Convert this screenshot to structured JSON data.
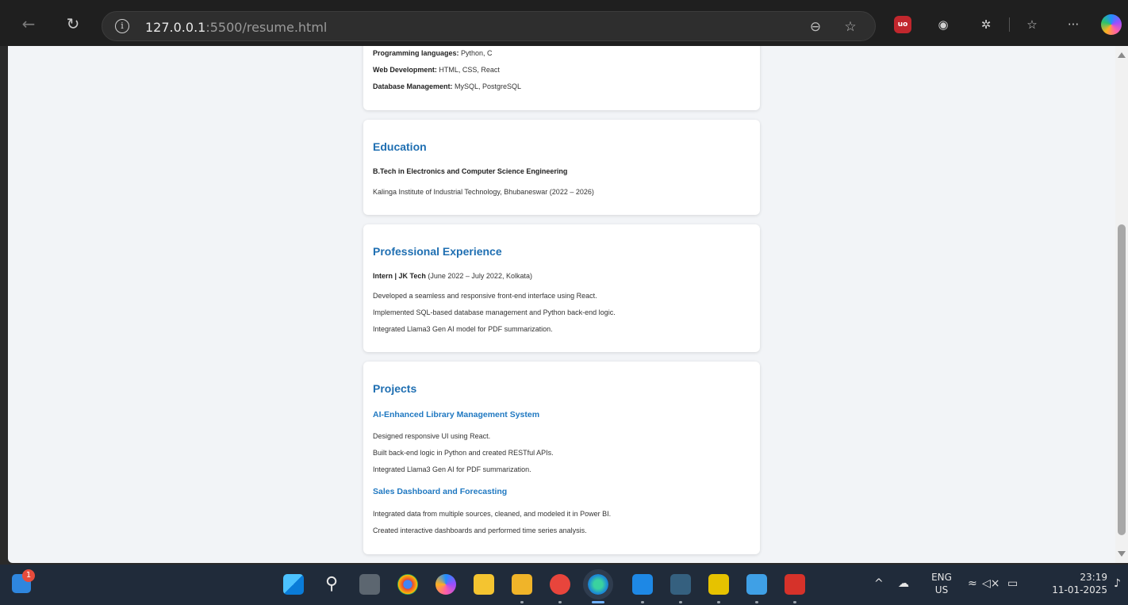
{
  "browser": {
    "url_host": "127.0.0.1",
    "url_rest": ":5500/resume.html"
  },
  "skills": [
    {
      "label": "Programming languages:",
      "value": " Python, C"
    },
    {
      "label": "Web Development:",
      "value": " HTML, CSS, React"
    },
    {
      "label": "Database Management:",
      "value": " MySQL, PostgreSQL"
    }
  ],
  "education": {
    "heading": "Education",
    "degree": "B.Tech in Electronics and Computer Science Engineering",
    "institution": "Kalinga Institute of Industrial Technology, Bhubaneswar (2022 – 2026)"
  },
  "experience": {
    "heading": "Professional Experience",
    "role": "Intern | JK Tech",
    "role_detail": " (June 2022 – July 2022, Kolkata)",
    "points": [
      "Developed a seamless and responsive front-end interface using React.",
      "Implemented SQL-based database management and Python back-end logic.",
      "Integrated Llama3 Gen AI model for PDF summarization."
    ]
  },
  "projects": {
    "heading": "Projects",
    "items": [
      {
        "title": "AI-Enhanced Library Management System",
        "points": [
          "Designed responsive UI using React.",
          "Built back-end logic in Python and created RESTful APIs.",
          "Integrated Llama3 Gen AI for PDF summarization."
        ]
      },
      {
        "title": "Sales Dashboard and Forecasting",
        "points": [
          "Integrated data from multiple sources, cleaned, and modeled it in Power BI.",
          "Created interactive dashboards and performed time series analysis."
        ]
      }
    ]
  },
  "taskbar": {
    "widget_badge": "1",
    "lang_top": "ENG",
    "lang_bottom": "US",
    "time": "23:19",
    "date": "11-01-2025"
  },
  "colors": {
    "heading": "#1f6fb2",
    "page_bg": "#f2f4f7",
    "taskbar_bg": "#202b3a"
  }
}
